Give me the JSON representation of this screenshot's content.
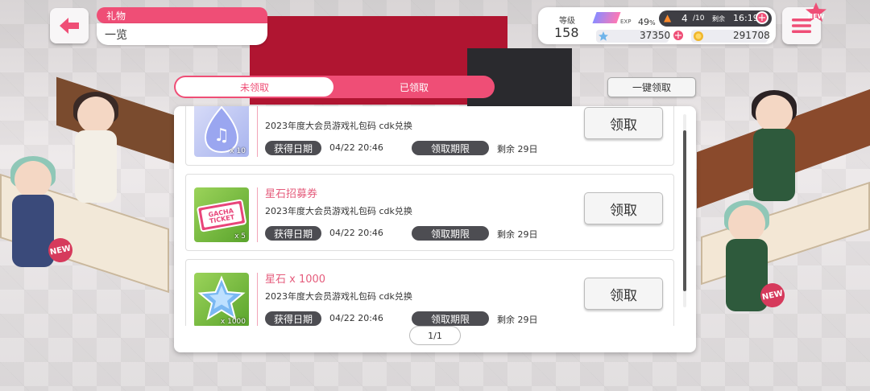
{
  "header": {
    "category": "礼物",
    "title": "一览"
  },
  "status": {
    "level_label": "等级",
    "level": "158",
    "exp_label": "EXP",
    "exp_percent": "49",
    "exp_unit": "%",
    "stamina": "4",
    "stamina_max": "/10",
    "remaining_label": "剩余",
    "time": "16:19",
    "star_gems": "37350",
    "coins": "291708"
  },
  "menu": {
    "new_badge": "NEW"
  },
  "tabs": [
    {
      "label": "未领取",
      "active": true
    },
    {
      "label": "已领取",
      "active": false
    }
  ],
  "claim_all_label": "一键领取",
  "items": [
    {
      "name": "",
      "description": "2023年度大会员游戏礼包码 cdk兑换",
      "count": "x 10",
      "icon": "music-crystal-icon",
      "obtain_label": "获得日期",
      "obtain_date": "04/22 20:46",
      "limit_label": "领取期限",
      "remaining": "剩余  29日",
      "claim_label": "领取"
    },
    {
      "name": "星石招募券",
      "description": "2023年度大会员游戏礼包码 cdk兑换",
      "count": "x 5",
      "icon": "gacha-ticket-icon",
      "ticket_text": "GACHA TICKET",
      "obtain_label": "获得日期",
      "obtain_date": "04/22 20:46",
      "limit_label": "领取期限",
      "remaining": "剩余  29日",
      "claim_label": "领取"
    },
    {
      "name": "星石 x 1000",
      "description": "2023年度大会员游戏礼包码 cdk兑换",
      "count": "x 1000",
      "icon": "star-gem-icon",
      "obtain_label": "获得日期",
      "obtain_date": "04/22 20:46",
      "limit_label": "领取期限",
      "remaining": "剩余  29日",
      "claim_label": "领取"
    }
  ],
  "pager": "1/1",
  "scene_badges": [
    "NEW",
    "NEW"
  ],
  "colors": {
    "accent": "#ef4e76",
    "pill": "#4d4d52",
    "item_name": "#e55c7c"
  }
}
